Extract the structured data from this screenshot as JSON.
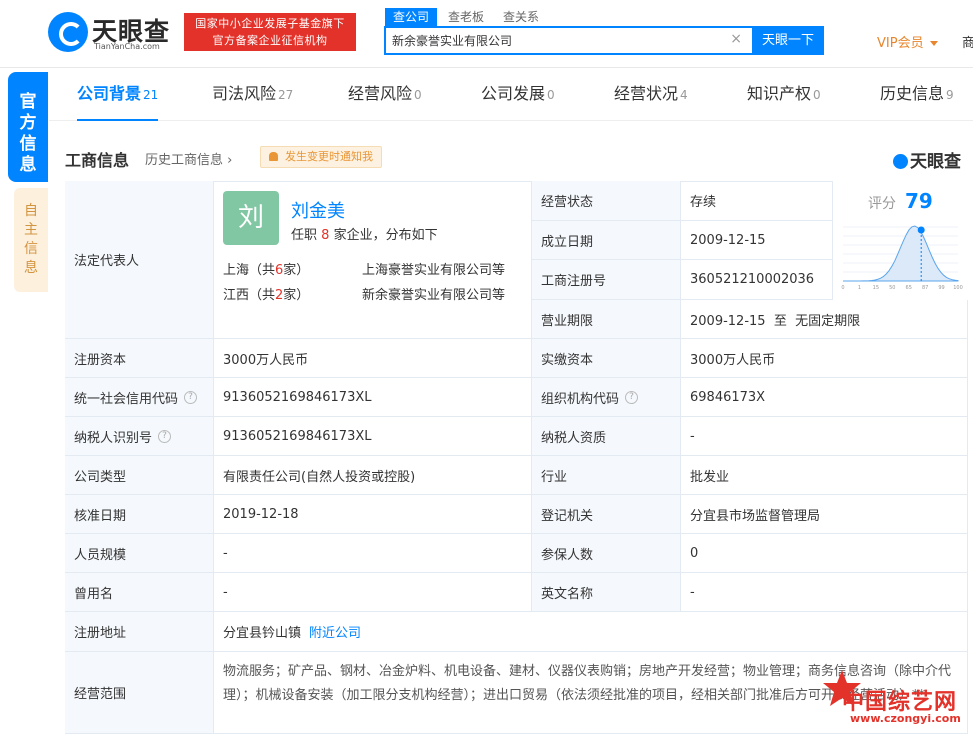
{
  "header": {
    "logo_cn": "天眼查",
    "logo_en": "TianYanCha.com",
    "badge_line1": "国家中小企业发展子基金旗下",
    "badge_line2": "官方备案企业征信机构",
    "search_tabs": [
      "查公司",
      "查老板",
      "查关系"
    ],
    "search_value": "新余豪誉实业有限公司",
    "search_clear": "×",
    "search_button": "天眼一下",
    "vip": "VIP会员",
    "edge_char": "商"
  },
  "sidebar": {
    "tab1": "官方信息",
    "tab2": "自主信息"
  },
  "nav": {
    "tabs": [
      {
        "label": "公司背景",
        "count": "21"
      },
      {
        "label": "司法风险",
        "count": "27"
      },
      {
        "label": "经营风险",
        "count": "0"
      },
      {
        "label": "公司发展",
        "count": "0"
      },
      {
        "label": "经营状况",
        "count": "4"
      },
      {
        "label": "知识产权",
        "count": "0"
      },
      {
        "label": "历史信息",
        "count": "9"
      }
    ]
  },
  "section": {
    "title": "工商信息",
    "history_link": "历史工商信息",
    "notify": "发生变更时通知我",
    "brand": "天眼查"
  },
  "legal_rep": {
    "label": "法定代表人",
    "avatar_char": "刘",
    "name": "刘金美",
    "info_prefix": "任职",
    "info_count": "8",
    "info_suffix": "家企业，分布如下",
    "rows": [
      {
        "region": "上海（共",
        "count": "6",
        "region_end": "家）",
        "company": "上海豪誉实业有限公司等"
      },
      {
        "region": "江西（共",
        "count": "2",
        "region_end": "家）",
        "company": "新余豪誉实业有限公司等"
      }
    ]
  },
  "score": {
    "label": "评分",
    "value": "79",
    "axis": [
      "0",
      "1",
      "15",
      "50",
      "65",
      "87",
      "99",
      "100"
    ],
    "marker_fraction": 0.79
  },
  "fields": {
    "status_label": "经营状态",
    "status": "存续",
    "established_label": "成立日期",
    "established": "2009-12-15",
    "regno_label": "工商注册号",
    "regno": "360521210002036",
    "term_label": "营业期限",
    "term": "2009-12-15  至  无固定期限",
    "capital_label": "注册资本",
    "capital": "3000万人民币",
    "paid_label": "实缴资本",
    "paid": "3000万人民币",
    "credit_label": "统一社会信用代码",
    "credit": "9136052169846173XL",
    "org_label": "组织机构代码",
    "org": "69846173X",
    "taxid_label": "纳税人识别号",
    "taxid": "9136052169846173XL",
    "taxq_label": "纳税人资质",
    "taxq": "-",
    "type_label": "公司类型",
    "type": "有限责任公司(自然人投资或控股)",
    "industry_label": "行业",
    "industry": "批发业",
    "approve_label": "核准日期",
    "approve": "2019-12-18",
    "authority_label": "登记机关",
    "authority": "分宜县市场监督管理局",
    "staff_label": "人员规模",
    "staff": "-",
    "insured_label": "参保人数",
    "insured": "0",
    "former_label": "曾用名",
    "former": "-",
    "english_label": "英文名称",
    "english": "-",
    "address_label": "注册地址",
    "address": "分宜县钤山镇",
    "address_link": "附近公司",
    "scope_label": "经营范围",
    "scope": "物流服务；矿产品、钢材、冶金炉料、机电设备、建材、仪器仪表购销；房地产开发经营；物业管理；商务信息咨询（除中介代理）；机械设备安装（加工限分支机构经营）；进出口贸易（依法须经批准的项目，经相关部门批准后方可开展经营活动）**",
    "help": "?"
  },
  "watermark": {
    "title": "中国综艺网",
    "url": "www.czongyi.com"
  },
  "colors": {
    "accent": "#0084ff",
    "red": "#e3322a",
    "orange": "#e8862d"
  }
}
